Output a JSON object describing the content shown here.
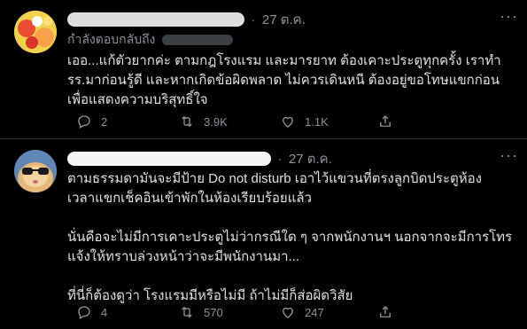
{
  "tweets": [
    {
      "time": "27 ต.ค.",
      "replying_label": "กำลังตอบกลับถึง",
      "body": "เออ...แก้ตัวยากค่ะ ตามกฎโรงแรม และมารยาท ต้องเคาะประตูทุกครั้ง เราทำ รร.มาก่อนรู้ดี และหากเกิดข้อผิดพลาด ไม่ควรเดินหนี ต้องอยู่ขอโทษแขกก่อน เพื่อแสดงความบริสุทธิ์ใจ",
      "replies": "2",
      "retweets": "3.9K",
      "likes": "1.1K"
    },
    {
      "time": "27 ต.ค.",
      "body": "ตามธรรมดามันจะมีป้าย Do not disturb เอาไว้แขวนที่ตรงลูกบิดประตูห้อง เวลาแขกเช็คอินเข้าพักในห้องเรียบร้อยแล้ว\n\nนั่นคือจะไม่มีการเคาะประตูไม่ว่ากรณีใด ๆ จากพนักงานฯ นอกจากจะมีการโทรแจ้งให้ทราบล่วงหน้าว่าจะมีพนักงานมา...\n\nที่นี่ก็ต้องดูว่า โรงแรมมีหรือไม่มี ถ้าไม่มีก็ส่อผิดวิสัย",
      "replies": "4",
      "retweets": "570",
      "likes": "247"
    }
  ],
  "icons": {
    "reply": "reply-icon",
    "retweet": "retweet-icon",
    "like": "heart-icon",
    "share": "share-icon",
    "more": "more-icon"
  },
  "colors": {
    "background": "#000000",
    "text": "#e0e0e0",
    "muted": "#8b9299",
    "divider": "#2f3336"
  }
}
